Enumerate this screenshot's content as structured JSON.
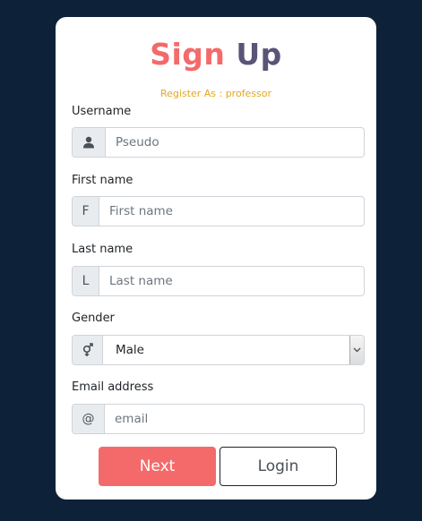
{
  "title": {
    "part1": "Sign",
    "part2": "Up"
  },
  "subtitle": "Register As : professor",
  "fields": {
    "username": {
      "label": "Username",
      "placeholder": "Pseudo",
      "icon": "user-icon"
    },
    "first_name": {
      "label": "First name",
      "addon": "F",
      "placeholder": "First name"
    },
    "last_name": {
      "label": "Last name",
      "addon": "L",
      "placeholder": "Last name"
    },
    "gender": {
      "label": "Gender",
      "selected": "Male",
      "icon": "gender-icon"
    },
    "email": {
      "label": "Email address",
      "addon": "@",
      "placeholder": "email"
    }
  },
  "buttons": {
    "next": "Next",
    "login": "Login"
  },
  "colors": {
    "background": "#0d2139",
    "accent": "#f46a6a",
    "title_secondary": "#5a5577",
    "subtitle": "#e4a81c"
  }
}
